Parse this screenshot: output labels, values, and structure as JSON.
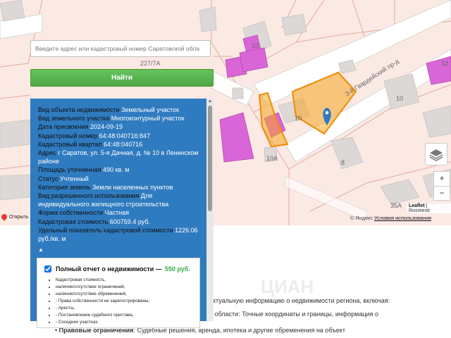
{
  "map": {
    "labels": {
      "house_10_top": "10",
      "house_227_7a": "227/7А",
      "house_10_mid": "10",
      "house_10a": "10А",
      "house_8": "8",
      "house_10_right": "10",
      "house_12": "12",
      "house_35a": "35А",
      "street": "3-й Гвардейский пр-д"
    },
    "attribution_link": "Leaflet",
    "attribution_rest": "| Rosreestr",
    "yandex": "© Яндекс",
    "terms": "Условия использования",
    "open_link": "Открыть",
    "zoom_in": "+",
    "zoom_out": "−",
    "parcel_color": "#f5a623",
    "building_color": "#d966d6"
  },
  "search": {
    "placeholder": "Введите адрес или кадастровый номер Саратовской обла",
    "button": "Найти"
  },
  "info": {
    "rows": [
      {
        "label": "Вид объекта недвижимости",
        "value": "Земельный участок"
      },
      {
        "label": "Вид земельного участка",
        "value": "Многоконтурный участок"
      },
      {
        "label": "Дата присвоения",
        "value": "2024-09-19"
      },
      {
        "label": "Кадастровый номер",
        "value": "64:48:040716:847"
      },
      {
        "label": "Кадастровый квартал",
        "value": "64:48:040716"
      },
      {
        "label": "Адрес",
        "value": "г Саратов, ул. 5-я Дачная, д. № 10 в Ленинском районе"
      },
      {
        "label": "Площадь уточненная",
        "value": "490 кв. м"
      },
      {
        "label": "Статус",
        "value": "Учтенный"
      },
      {
        "label": "Категория земель",
        "value": "Земли населенных пунктов"
      },
      {
        "label": "Вид разрешенного использования",
        "value": "Для индивидуального жилищного строительства"
      },
      {
        "label": "Форма собственности",
        "value": "Частная"
      },
      {
        "label": "Кадастровая стоимость",
        "value": "600759.4 руб."
      },
      {
        "label": "Удельный показатель кадастровой стоимости",
        "value": "1226.06 руб./кв. м"
      }
    ],
    "toggle": "▲"
  },
  "report": {
    "title": "Полный отчет о недвижимости —",
    "price": "550 руб.",
    "items": [
      "Кадастровая стоимость,",
      "наличие/отсутствие ограничений,",
      "наличие/отсутствие обременений,",
      "- Права собственности не зарегистрированы,",
      "- Аресты,",
      "- Постановление судебного пристава,",
      "- Соседних участках."
    ]
  },
  "background": {
    "line1": "актуальную информацию о недвижимости региона, включая:",
    "line2": "й области: Точные координаты и границы, информация о",
    "bullet_bold": "Правовые ограничения",
    "bullet_rest": ": Судебные решения, аренда, ипотека и другие обременения на объект",
    "watermark": "ЦИАН"
  }
}
